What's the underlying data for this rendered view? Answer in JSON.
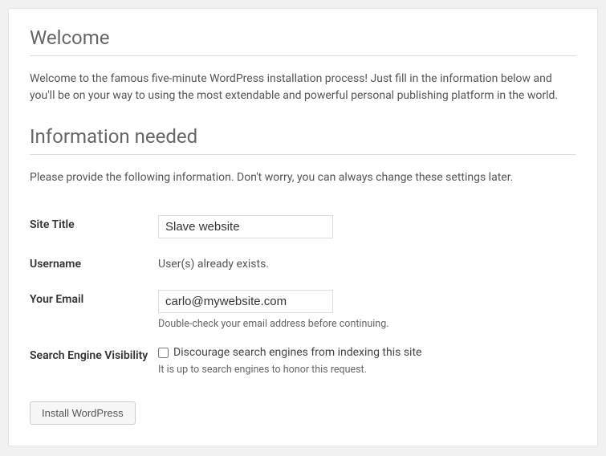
{
  "welcome": {
    "heading": "Welcome",
    "intro": "Welcome to the famous five-minute WordPress installation process! Just fill in the information below and you'll be on your way to using the most extendable and powerful personal publishing platform in the world."
  },
  "info": {
    "heading": "Information needed",
    "intro": "Please provide the following information. Don't worry, you can always change these settings later."
  },
  "fields": {
    "site_title": {
      "label": "Site Title",
      "value": "Slave website"
    },
    "username": {
      "label": "Username",
      "note": "User(s) already exists."
    },
    "email": {
      "label": "Your Email",
      "value": "carlo@mywebsite.com",
      "description": "Double-check your email address before continuing."
    },
    "search_visibility": {
      "label": "Search Engine Visibility",
      "checkbox_label": "Discourage search engines from indexing this site",
      "description": "It is up to search engines to honor this request."
    }
  },
  "submit": {
    "label": "Install WordPress"
  }
}
